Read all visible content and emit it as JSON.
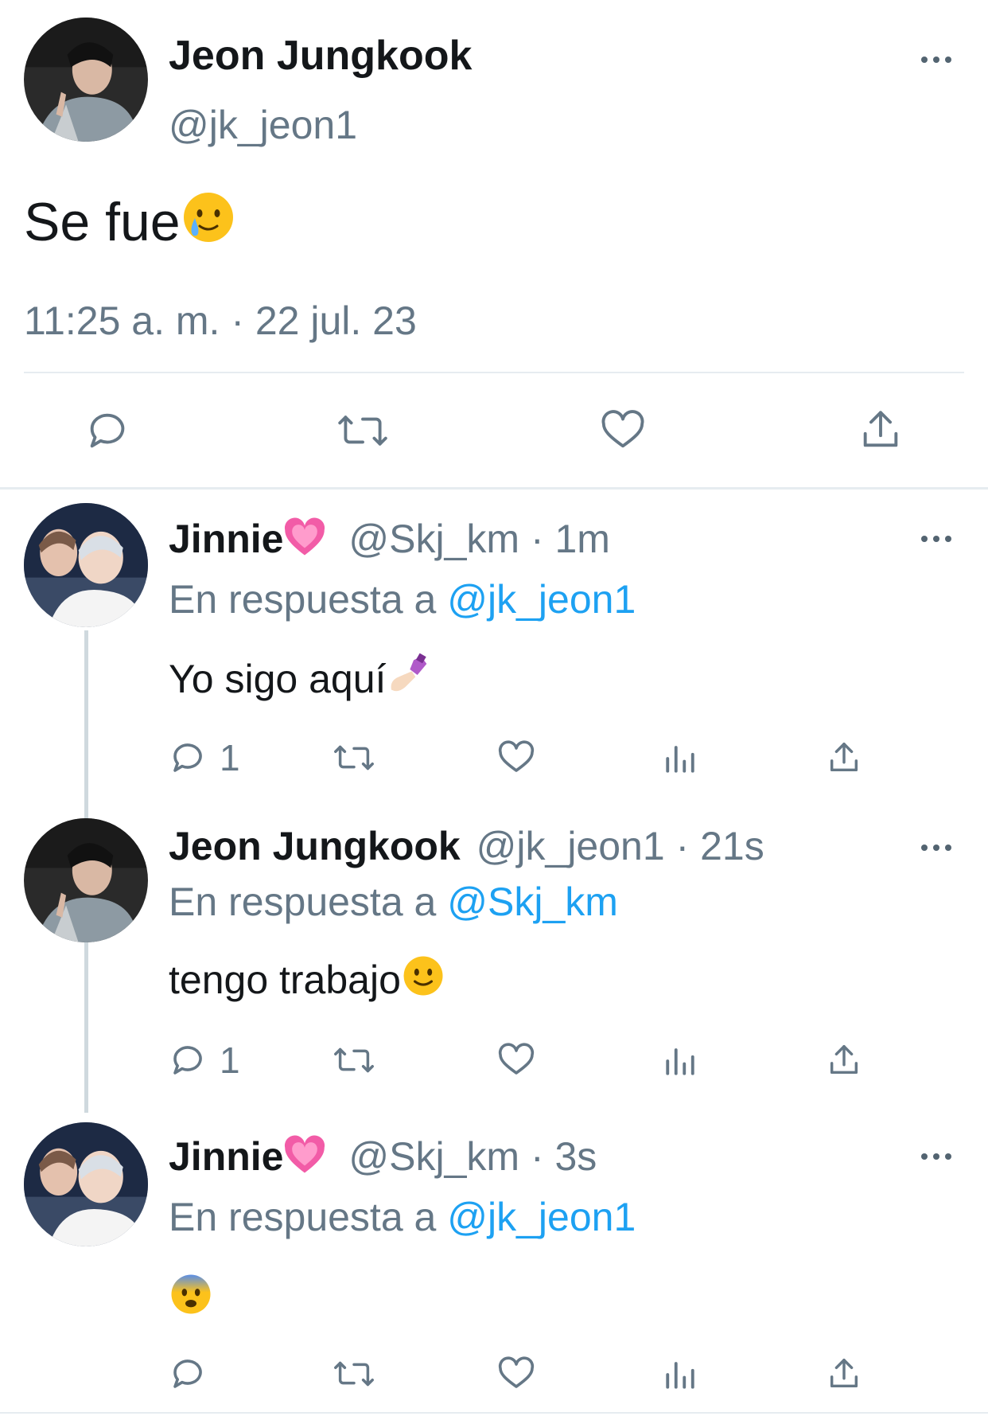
{
  "main_tweet": {
    "author_name": "Jeon Jungkook",
    "handle": "@jk_jeon1",
    "text": "Se fue",
    "text_emoji": "crying-smiling-face",
    "timestamp": "11:25 a. m. · 22 jul. 23"
  },
  "replies": [
    {
      "author_name": "Jinnie",
      "name_emoji": "pink-heart",
      "meta": "@Skj_km · 1m",
      "reply_prefix": "En respuesta a",
      "reply_to": "@jk_jeon1",
      "text": "Yo sigo aquí",
      "text_emoji": "nail-polish",
      "reply_count": "1"
    },
    {
      "author_name": "Jeon Jungkook",
      "meta": "@jk_jeon1 · 21s",
      "reply_prefix": "En respuesta a",
      "reply_to": "@Skj_km",
      "text": "tengo trabajo",
      "text_emoji": "slightly-smiling-face",
      "reply_count": "1"
    },
    {
      "author_name": "Jinnie",
      "name_emoji": "pink-heart",
      "meta": "@Skj_km · 3s",
      "reply_prefix": "En respuesta a",
      "reply_to": "@jk_jeon1",
      "text": "",
      "text_emoji": "anxious-face",
      "reply_count": ""
    }
  ],
  "colors": {
    "link": "#1da1f2",
    "secondary_text": "#657786",
    "icon": "#657786",
    "primary_text": "#14171a"
  }
}
